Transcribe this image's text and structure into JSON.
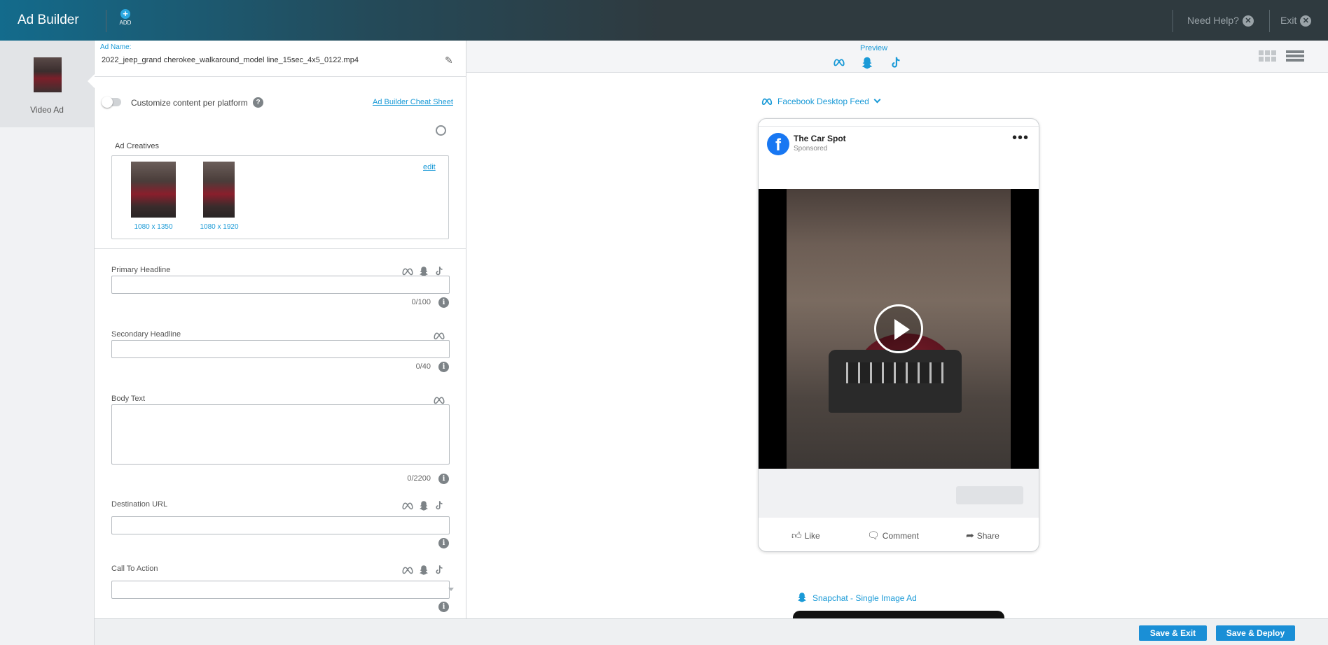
{
  "topbar": {
    "title": "Ad Builder",
    "add_label": "ADD",
    "help_label": "Need Help?",
    "exit_label": "Exit"
  },
  "leftnav": {
    "item_label": "Video Ad"
  },
  "editor": {
    "ad_name_label": "Ad Name:",
    "ad_name_value": "2022_jeep_grand cherokee_walkaround_model line_15sec_4x5_0122.mp4",
    "customize_label": "Customize content per platform",
    "help_char": "?",
    "cheat_sheet_label": "Ad Builder Cheat Sheet",
    "creatives": {
      "label": "Ad Creatives",
      "edit_label": "edit",
      "items": [
        {
          "caption": "1080 x 1350"
        },
        {
          "caption": "1080 x 1920"
        }
      ]
    },
    "fields": {
      "primary_headline": {
        "label": "Primary Headline",
        "counter": "0/100"
      },
      "secondary_headline": {
        "label": "Secondary Headline",
        "counter": "0/40"
      },
      "body_text": {
        "label": "Body Text",
        "counter": "0/2200"
      },
      "destination_url": {
        "label": "Destination URL"
      },
      "call_to_action": {
        "label": "Call To Action"
      }
    },
    "info_char": "i"
  },
  "preview": {
    "label": "Preview",
    "feed_label": "Facebook Desktop Feed",
    "post": {
      "page_name": "The Car Spot",
      "sponsored": "Sponsored",
      "fb_letter": "f",
      "more_glyph": "•••"
    },
    "actions": {
      "like": "Like",
      "comment": "Comment",
      "share": "Share"
    },
    "snapchat_label": "Snapchat - Single Image Ad"
  },
  "footer": {
    "save_exit": "Save & Exit",
    "save_deploy": "Save & Deploy"
  },
  "colors": {
    "accent": "#1a9ad7",
    "button": "#1a8fd6",
    "header_dark": "#2f3a3f",
    "facebook": "#1877f2"
  }
}
